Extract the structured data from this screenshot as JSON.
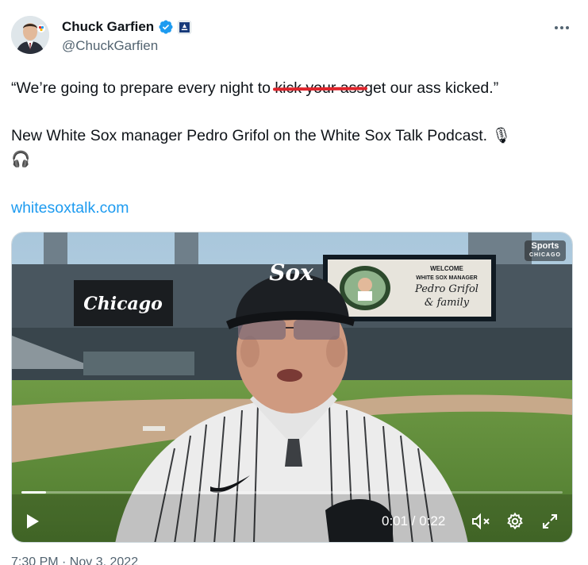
{
  "tweet": {
    "author": {
      "name": "Chuck Garfien",
      "handle": "@ChuckGarfien",
      "avatar_icon": "person-avatar",
      "verified_icon": "verified-badge-icon",
      "affiliate_icon": "nbc-sports-affiliate-icon"
    },
    "more_icon": "more-options-icon",
    "text": {
      "quote_open": "“We’re going to prepare every night to ",
      "struck": "kick your ass",
      "quote_close": "get our ass kicked.”",
      "line2": "New White Sox manager Pedro Grifol on the White Sox Talk Podcast. 🎙",
      "line2_icon": "🎧"
    },
    "link": "whitesoxtalk.com",
    "video": {
      "overlay": {
        "sign_chicago": "Chicago",
        "sign_welcome_1": "WELCOME",
        "sign_welcome_2": "WHITE SOX MANAGER",
        "sign_welcome_3": "Pedro Grifol",
        "sign_welcome_4": "& family",
        "logo_main": "Sports",
        "logo_sub": "CHICAGO",
        "cap_logo": "Sox"
      },
      "progress": 0.045,
      "time": "0:01 / 0:22",
      "controls": {
        "play_icon": "play-icon",
        "mute_icon": "muted-speaker-icon",
        "settings_icon": "gear-icon",
        "fullscreen_icon": "fullscreen-icon"
      }
    },
    "timestamp_cut": "7:30 PM · Nov 3, 2022"
  },
  "colors": {
    "link": "#1d9bf0",
    "verified": "#1d9bf0",
    "strike": "#e0242b"
  }
}
